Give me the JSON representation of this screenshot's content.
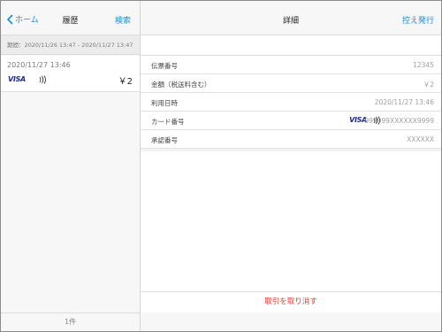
{
  "left": {
    "nav": {
      "back_label": "ホーム",
      "title": "履歴",
      "search_label": "検索"
    },
    "period_text": "期間：2020/11/26 13:47 - 2020/11/27 13:47",
    "items": [
      {
        "date": "2020/11/27 13:46",
        "brand": "VISA",
        "contactless_icon": "contactless-icon",
        "amount": "￥2"
      }
    ],
    "footer_count": "1件"
  },
  "right": {
    "nav": {
      "title": "詳細",
      "receipt_label": "控え発行"
    },
    "rows": [
      {
        "label": "伝票番号",
        "value": "12345"
      },
      {
        "label": "金額（税送料含む）",
        "value": "￥2"
      },
      {
        "label": "利用日時",
        "value": "2020/11/27 13:46"
      },
      {
        "label": "カード番号",
        "value": "999999XXXXXX9999",
        "brand": "VISA"
      },
      {
        "label": "承認番号",
        "value": "XXXXXX"
      }
    ],
    "cancel_label": "取引を取り消す"
  },
  "colors": {
    "accent": "#1b8bd7",
    "danger": "#e23b2f",
    "visa": "#1a2a8c"
  }
}
